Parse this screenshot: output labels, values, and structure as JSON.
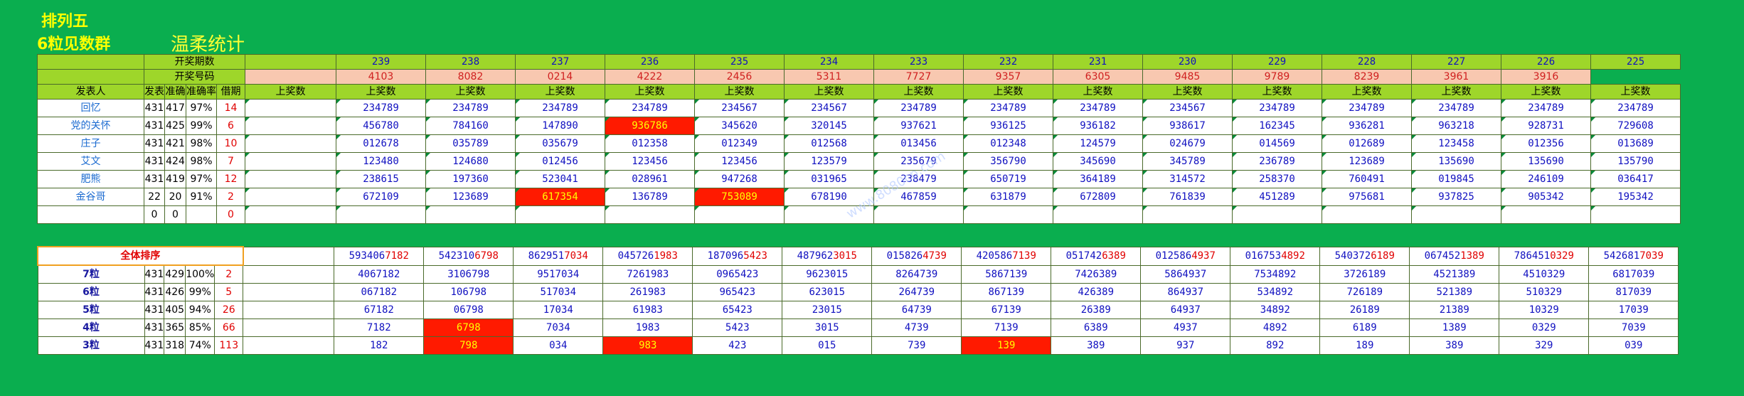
{
  "title_main": "排列五",
  "title_sub": "6粒见数群",
  "title_stat": "温柔统计",
  "watermark": "www.8080cp.com",
  "header": {
    "period_label": "开奖期数",
    "number_label": "开奖号码",
    "publisher_label": "发表人",
    "publish_label": "发表",
    "correct_label": "准确",
    "rate_label": "准确率",
    "miss_label": "借期",
    "last_label": "上奖数",
    "periods": [
      "239",
      "238",
      "237",
      "236",
      "235",
      "234",
      "233",
      "232",
      "231",
      "230",
      "229",
      "228",
      "227",
      "226",
      "225"
    ],
    "numbers": [
      "",
      "4103",
      "8082",
      "0214",
      "4222",
      "2456",
      "5311",
      "7727",
      "9357",
      "6305",
      "9485",
      "9789",
      "8239",
      "3961",
      "3916"
    ]
  },
  "rows": [
    {
      "name": "回忆",
      "publish": "431",
      "correct": "417",
      "rate": "97%",
      "miss": "14",
      "cells": [
        "",
        "234789",
        "234789",
        "234789",
        "234789",
        "234567",
        "234567",
        "234789",
        "234789",
        "234789",
        "234567",
        "234789",
        "234789",
        "234789",
        "234789",
        "234789"
      ],
      "hl": []
    },
    {
      "name": "党的关怀",
      "publish": "431",
      "correct": "425",
      "rate": "99%",
      "miss": "6",
      "cells": [
        "",
        "456780",
        "784160",
        "147890",
        "936786",
        "345620",
        "320145",
        "937621",
        "936125",
        "936182",
        "938617",
        "162345",
        "936281",
        "963218",
        "928731",
        "729608"
      ],
      "hl": [
        4
      ]
    },
    {
      "name": "庄子",
      "publish": "431",
      "correct": "421",
      "rate": "98%",
      "miss": "10",
      "cells": [
        "",
        "012678",
        "035789",
        "035679",
        "012358",
        "012349",
        "012568",
        "013456",
        "012348",
        "124579",
        "024679",
        "014569",
        "012689",
        "123458",
        "012356",
        "013689"
      ],
      "hl": []
    },
    {
      "name": "艾文",
      "publish": "431",
      "correct": "424",
      "rate": "98%",
      "miss": "7",
      "cells": [
        "",
        "123480",
        "124680",
        "012456",
        "123456",
        "123456",
        "123579",
        "235679",
        "356790",
        "345690",
        "345789",
        "236789",
        "123689",
        "135690",
        "135690",
        "135790"
      ],
      "hl": []
    },
    {
      "name": "肥熊",
      "publish": "431",
      "correct": "419",
      "rate": "97%",
      "miss": "12",
      "cells": [
        "",
        "238615",
        "197360",
        "523041",
        "028961",
        "947268",
        "031965",
        "238479",
        "650719",
        "364189",
        "314572",
        "258370",
        "760491",
        "019845",
        "246109",
        "036417"
      ],
      "hl": []
    },
    {
      "name": "金谷哥",
      "publish": "22",
      "correct": "20",
      "rate": "91%",
      "miss": "2",
      "cells": [
        "",
        "672109",
        "123689",
        "617354",
        "136789",
        "753089",
        "678190",
        "467859",
        "631879",
        "672809",
        "761839",
        "451289",
        "975681",
        "937825",
        "905342",
        "195342"
      ],
      "hl": [
        3,
        5
      ]
    },
    {
      "name": "",
      "publish": "0",
      "correct": "0",
      "rate": "",
      "miss": "0",
      "cells": [
        "",
        "",
        "",
        "",
        "",
        "",
        "",
        "",
        "",
        "",
        "",
        "",
        "",
        "",
        "",
        ""
      ],
      "hl": []
    }
  ],
  "rank_title": "全体排序",
  "rank_header": [
    "",
    "5934067182",
    "5423106798",
    "8629517034",
    "0457261983",
    "1870965423",
    "4879623015",
    "0158264739",
    "4205867139",
    "0517426389",
    "0125864937",
    "0167534892",
    "5403726189",
    "0674521389",
    "7864510329",
    "5426817039"
  ],
  "rank_rows": [
    {
      "name": "7粒",
      "publish": "431",
      "correct": "429",
      "rate": "100%",
      "miss": "2",
      "cells": [
        "",
        "4067182",
        "3106798",
        "9517034",
        "7261983",
        "0965423",
        "9623015",
        "8264739",
        "5867139",
        "7426389",
        "5864937",
        "7534892",
        "3726189",
        "4521389",
        "4510329",
        "6817039"
      ],
      "hl": []
    },
    {
      "name": "6粒",
      "publish": "431",
      "correct": "426",
      "rate": "99%",
      "miss": "5",
      "cells": [
        "",
        "067182",
        "106798",
        "517034",
        "261983",
        "965423",
        "623015",
        "264739",
        "867139",
        "426389",
        "864937",
        "534892",
        "726189",
        "521389",
        "510329",
        "817039"
      ],
      "hl": []
    },
    {
      "name": "5粒",
      "publish": "431",
      "correct": "405",
      "rate": "94%",
      "miss": "26",
      "cells": [
        "",
        "67182",
        "06798",
        "17034",
        "61983",
        "65423",
        "23015",
        "64739",
        "67139",
        "26389",
        "64937",
        "34892",
        "26189",
        "21389",
        "10329",
        "17039"
      ],
      "hl": []
    },
    {
      "name": "4粒",
      "publish": "431",
      "correct": "365",
      "rate": "85%",
      "miss": "66",
      "cells": [
        "",
        "7182",
        "6798",
        "7034",
        "1983",
        "5423",
        "3015",
        "4739",
        "7139",
        "6389",
        "4937",
        "4892",
        "6189",
        "1389",
        "0329",
        "7039"
      ],
      "hl": [
        2
      ]
    },
    {
      "name": "3粒",
      "publish": "431",
      "correct": "318",
      "rate": "74%",
      "miss": "113",
      "cells": [
        "",
        "182",
        "798",
        "034",
        "983",
        "423",
        "015",
        "739",
        "139",
        "389",
        "937",
        "892",
        "189",
        "389",
        "329",
        "039"
      ],
      "hl": [
        2,
        4,
        8
      ]
    }
  ],
  "colors": {
    "background": "#0aae4f",
    "header_green": "#9ed62a",
    "header_pink": "#f8c8b0",
    "highlight": "#ff1a00",
    "number_text": "#1010c0"
  }
}
